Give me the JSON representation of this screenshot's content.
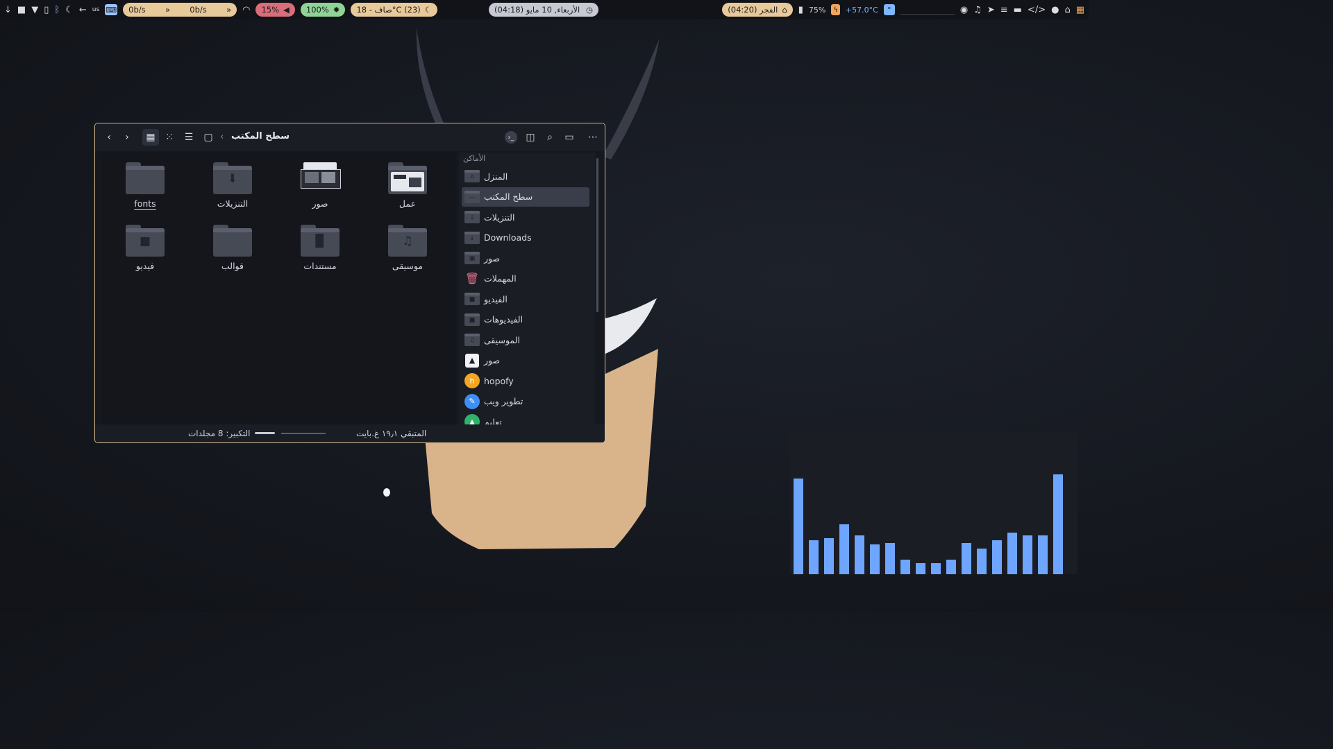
{
  "topbar": {
    "kbd_layout": "us",
    "net_down": "0b/s",
    "net_up": "0b/s",
    "volume": "15%",
    "brightness": "100%",
    "weather": "صاف - 18°C (23)",
    "clock": "(04:18) الأربعاء, 10 مايو",
    "prayer": "الفجر (04:20)",
    "battery": "75%",
    "cpu_temp": "+57.0°C",
    "icons": [
      "download-icon",
      "square-icon",
      "wifi-icon",
      "clipboard-icon",
      "bluetooth-icon",
      "night-light-icon",
      "back-arrow-icon",
      "keyboard-icon",
      "gamepad-icon",
      "music-icon",
      "telegram-icon",
      "database-icon",
      "folder-icon",
      "code-icon",
      "firefox-icon",
      "home-icon",
      "color-palette-icon"
    ]
  },
  "window": {
    "breadcrumb": "سطح المكتب",
    "tiles": [
      {
        "label": "عمل",
        "kind": "thumb"
      },
      {
        "label": "صور",
        "kind": "thumb"
      },
      {
        "label": "التنزيلات",
        "kind": "download"
      },
      {
        "label": "fonts",
        "kind": "plain"
      },
      {
        "label": "موسيقى",
        "kind": "music"
      },
      {
        "label": "مستندات",
        "kind": "doc"
      },
      {
        "label": "قوالب",
        "kind": "plain"
      },
      {
        "label": "فيديو",
        "kind": "video"
      }
    ],
    "status_free": "المتبقي ١٩٫١ غ.بايت",
    "status_zoom": "التكبير: 8 مجلدات",
    "zoom_level": 0.45,
    "sidebar_header": "الأماكن",
    "sidebar": [
      {
        "label": "المنزل",
        "icon": "home",
        "selected": false
      },
      {
        "label": "سطح المكتب",
        "icon": "desktop",
        "selected": true
      },
      {
        "label": "التنزيلات",
        "icon": "download",
        "selected": false
      },
      {
        "label": "Downloads",
        "icon": "download",
        "selected": false
      },
      {
        "label": "صور",
        "icon": "image",
        "selected": false
      },
      {
        "label": "المهملات",
        "icon": "trash",
        "selected": false
      },
      {
        "label": "الفيديو",
        "icon": "video",
        "selected": false
      },
      {
        "label": "الفيديوهات",
        "icon": "video",
        "selected": false
      },
      {
        "label": "الموسيقى",
        "icon": "music",
        "selected": false
      },
      {
        "label": "صور",
        "icon": "photo",
        "selected": false
      },
      {
        "label": "hopofy",
        "icon": "hopofy",
        "selected": false
      },
      {
        "label": "تطوير ويب",
        "icon": "webdev",
        "selected": false
      },
      {
        "label": "تعليم",
        "icon": "education",
        "selected": false
      }
    ]
  },
  "visualizer": {
    "color": "#6ea6ff",
    "levels": [
      0.67,
      0.24,
      0.25,
      0.35,
      0.27,
      0.21,
      0.22,
      0.1,
      0.08,
      0.08,
      0.1,
      0.22,
      0.18,
      0.24,
      0.29,
      0.27,
      0.27,
      0.7
    ]
  },
  "colors": {
    "window_border": "#d7bd91",
    "accent_blue": "#6ea6ff"
  }
}
